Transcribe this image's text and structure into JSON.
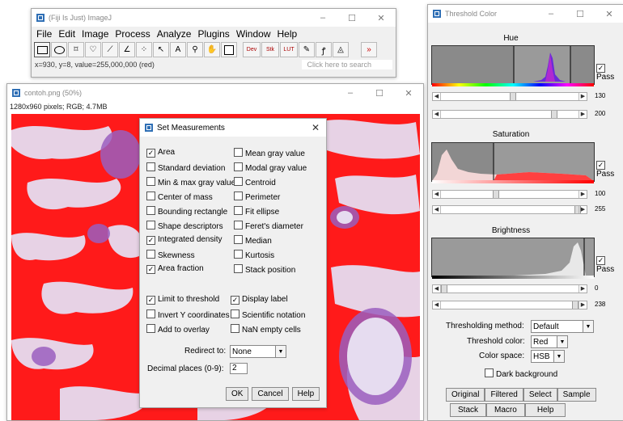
{
  "imagej": {
    "title": "(Fiji Is Just) ImageJ",
    "menu": [
      "File",
      "Edit",
      "Image",
      "Process",
      "Analyze",
      "Plugins",
      "Window",
      "Help"
    ],
    "status": "x=930, y=8, value=255,000,000 (red)",
    "search_placeholder": "Click here to search",
    "tool_dev": "Dev",
    "tool_stk": "Stk",
    "tool_lut": "LUT",
    "more": "»"
  },
  "image_window": {
    "title": "contoh.png (50%)",
    "info": "1280x960 pixels; RGB; 4.7MB"
  },
  "set_measurements": {
    "title": "Set Measurements",
    "left_items": [
      {
        "label": "Area",
        "checked": true
      },
      {
        "label": "Standard deviation",
        "checked": false
      },
      {
        "label": "Min & max gray value",
        "checked": false
      },
      {
        "label": "Center of mass",
        "checked": false
      },
      {
        "label": "Bounding rectangle",
        "checked": false
      },
      {
        "label": "Shape descriptors",
        "checked": false
      },
      {
        "label": "Integrated density",
        "checked": true
      },
      {
        "label": "Skewness",
        "checked": false
      },
      {
        "label": "Area fraction",
        "checked": true
      }
    ],
    "right_items": [
      {
        "label": "Mean gray value",
        "checked": false
      },
      {
        "label": "Modal gray value",
        "checked": false
      },
      {
        "label": "Centroid",
        "checked": false
      },
      {
        "label": "Perimeter",
        "checked": false
      },
      {
        "label": "Fit ellipse",
        "checked": false
      },
      {
        "label": "Feret's diameter",
        "checked": false
      },
      {
        "label": "Median",
        "checked": false
      },
      {
        "label": "Kurtosis",
        "checked": false
      },
      {
        "label": "Stack position",
        "checked": false
      }
    ],
    "left_options": [
      {
        "label": "Limit to threshold",
        "checked": true
      },
      {
        "label": "Invert Y coordinates",
        "checked": false
      },
      {
        "label": "Add to overlay",
        "checked": false
      }
    ],
    "right_options": [
      {
        "label": "Display label",
        "checked": true
      },
      {
        "label": "Scientific notation",
        "checked": false
      },
      {
        "label": "NaN empty cells",
        "checked": false
      }
    ],
    "redirect_label": "Redirect to:",
    "redirect_value": "None",
    "decimal_label": "Decimal places (0-9):",
    "decimal_value": "2",
    "ok": "OK",
    "cancel": "Cancel",
    "help": "Help"
  },
  "threshold": {
    "title": "Threshold Color",
    "hue_label": "Hue",
    "sat_label": "Saturation",
    "bri_label": "Brightness",
    "pass": "Pass",
    "hue_min": "130",
    "hue_max": "200",
    "sat_min": "100",
    "sat_max": "255",
    "bri_min": "0",
    "bri_max": "238",
    "method_label": "Thresholding method:",
    "method_value": "Default",
    "color_label": "Threshold color:",
    "color_value": "Red",
    "space_label": "Color space:",
    "space_value": "HSB",
    "dark_bg": "Dark background",
    "buttons_row1": [
      "Original",
      "Filtered",
      "Select",
      "Sample"
    ],
    "buttons_row2": [
      "Stack",
      "Macro",
      "Help"
    ]
  },
  "colors": {
    "threshold_red": "#ff1a1a",
    "tissue_light": "#e6dcf0",
    "tissue_purple": "#9a5fbf",
    "titlebar_icon": "#2f6fb5"
  }
}
